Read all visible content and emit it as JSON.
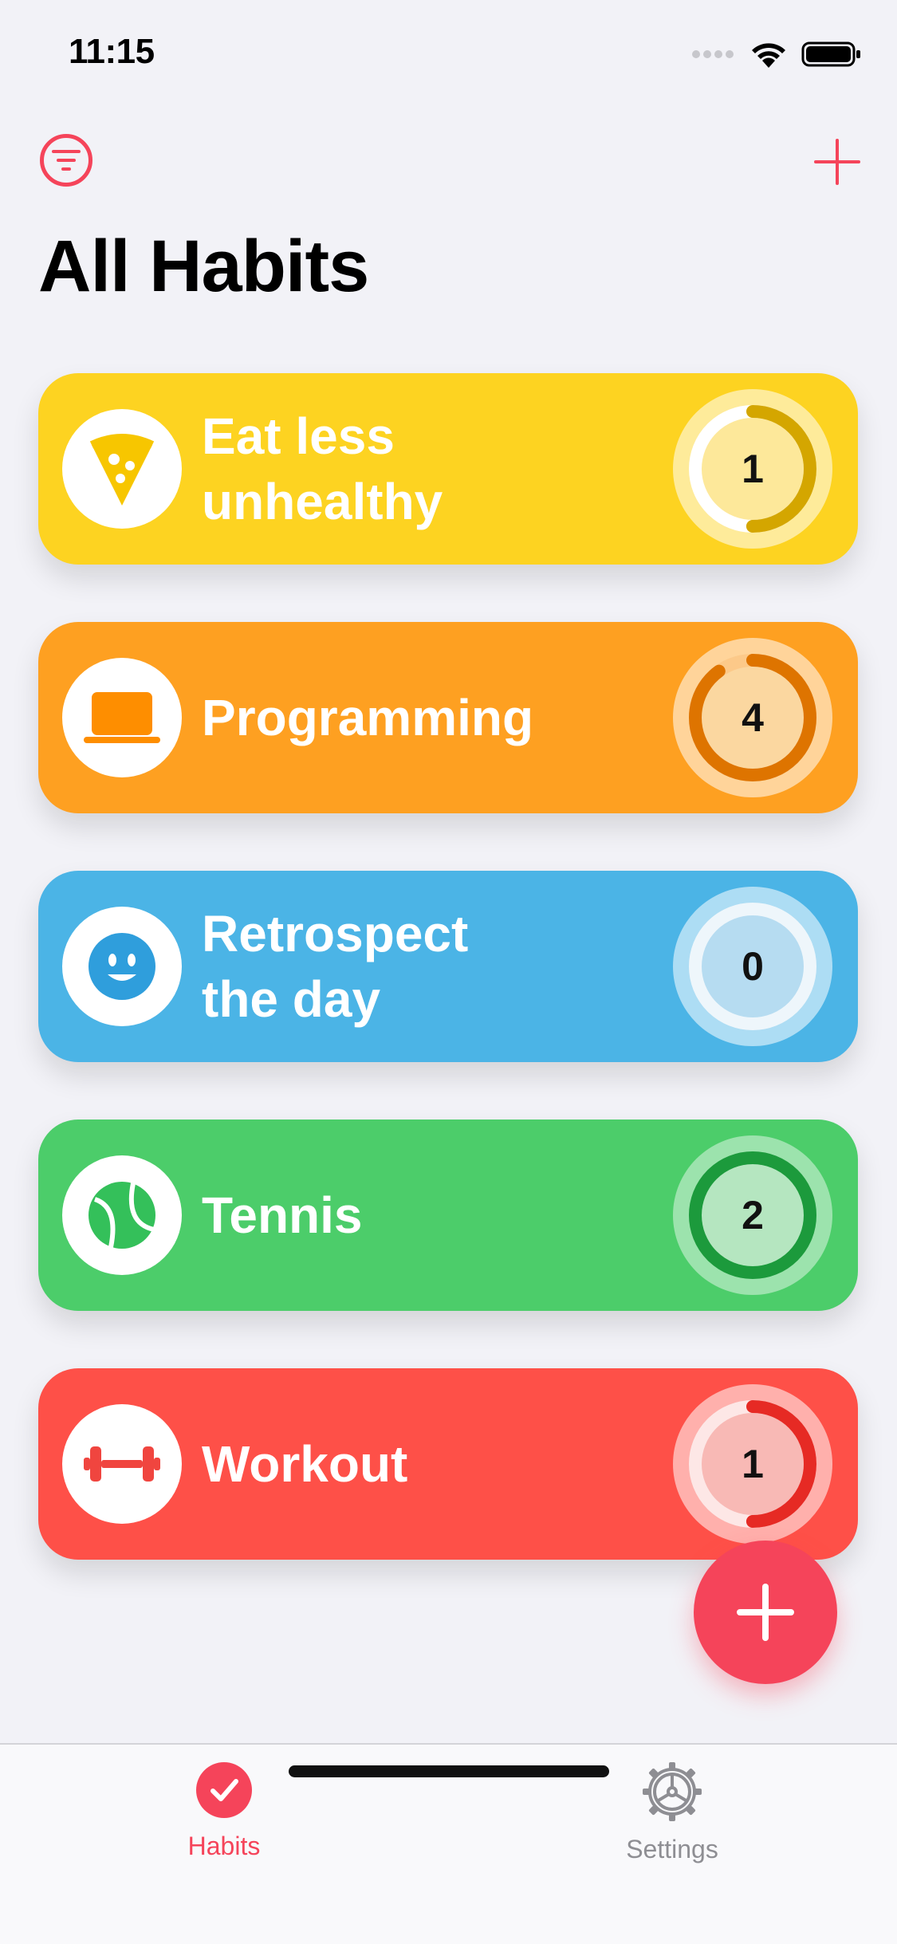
{
  "status": {
    "time": "11:15"
  },
  "header": {
    "title": "All Habits"
  },
  "habits": [
    {
      "name": "Eat less unhealthy",
      "count": "1",
      "icon": "pizza-icon",
      "color": "#fdd321",
      "progress": 0.5
    },
    {
      "name": "Programming",
      "count": "4",
      "icon": "laptop-icon",
      "color": "#fea021",
      "progress": 0.9
    },
    {
      "name": "Retrospect the day",
      "count": "0",
      "icon": "smiley-icon",
      "color": "#4bb4e6",
      "progress": 0
    },
    {
      "name": "Tennis",
      "count": "2",
      "icon": "tennis-ball-icon",
      "color": "#4ccd6a",
      "progress": 1.0
    },
    {
      "name": "Workout",
      "count": "1",
      "icon": "dumbbell-icon",
      "color": "#fe5048",
      "progress": 0.5
    }
  ],
  "tabs": [
    {
      "label": "Habits",
      "icon": "checkmark-circle-icon",
      "active": true
    },
    {
      "label": "Settings",
      "icon": "gear-icon",
      "active": false
    }
  ],
  "colors": {
    "accent": "#f5445a",
    "inactive": "#8e8e93"
  }
}
